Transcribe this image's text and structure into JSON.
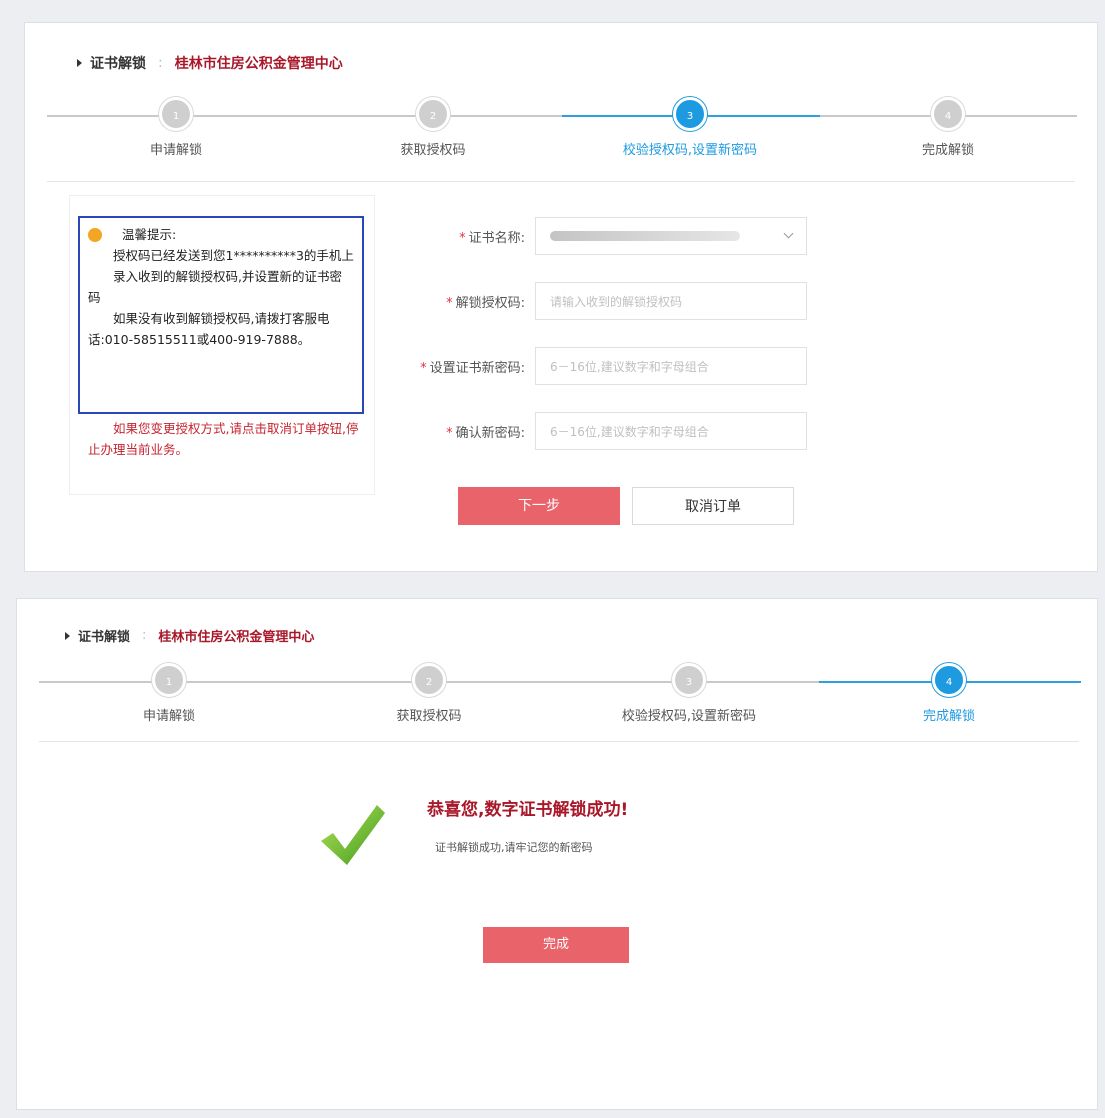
{
  "panel1": {
    "crumb": {
      "title": "证书解锁",
      "sep": ":",
      "org": "桂林市住房公积金管理中心"
    },
    "steps": [
      {
        "num": "1",
        "label": "申请解锁"
      },
      {
        "num": "2",
        "label": "获取授权码"
      },
      {
        "num": "3",
        "label": "校验授权码,设置新密码"
      },
      {
        "num": "4",
        "label": "完成解锁"
      }
    ],
    "active_step": 3,
    "tips": {
      "heading": "温馨提示:",
      "line1": "授权码已经发送到您1**********3的手机上",
      "line2": "录入收到的解锁授权码,并设置新的证书密码",
      "line3": "如果没有收到解锁授权码,请拨打客服电话:010-58515511或400-919-7888。",
      "red": "如果您变更授权方式,请点击取消订单按钮,停止办理当前业务。"
    },
    "form": {
      "cert_name_label": "证书名称:",
      "auth_code_label": "解锁授权码:",
      "auth_code_placeholder": "请输入收到的解锁授权码",
      "new_pwd_label": "设置证书新密码:",
      "new_pwd_placeholder": "6－16位,建议数字和字母组合",
      "confirm_pwd_label": "确认新密码:",
      "confirm_pwd_placeholder": "6－16位,建议数字和字母组合",
      "required_mark": "*"
    },
    "next_button": "下一步",
    "cancel_button": "取消订单"
  },
  "panel2": {
    "crumb": {
      "title": "证书解锁",
      "sep": ":",
      "org": "桂林市住房公积金管理中心"
    },
    "steps": [
      {
        "num": "1",
        "label": "申请解锁"
      },
      {
        "num": "2",
        "label": "获取授权码"
      },
      {
        "num": "3",
        "label": "校验授权码,设置新密码"
      },
      {
        "num": "4",
        "label": "完成解锁"
      }
    ],
    "active_step": 4,
    "success_title": "恭喜您,数字证书解锁成功!",
    "success_sub": "证书解锁成功,请牢记您的新密码",
    "done_button": "完成"
  },
  "colors": {
    "accent": "#1e9ae0",
    "primary_button": "#e8636a",
    "brand_red": "#a8182a",
    "tips_border": "#2947b8"
  }
}
